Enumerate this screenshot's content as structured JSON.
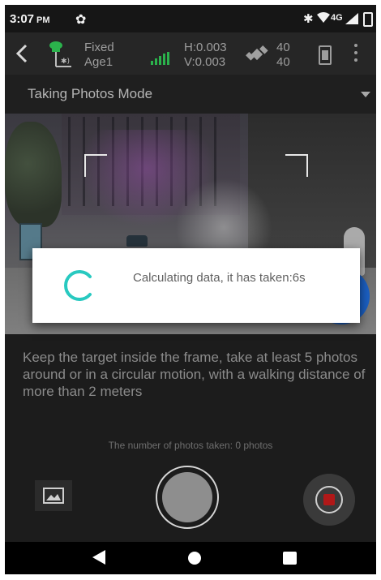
{
  "status_bar": {
    "time": "3:07",
    "ampm": "PM",
    "network_type": "4G",
    "icons": [
      "gear-icon",
      "bluetooth-icon",
      "wifi-icon",
      "signal-icon",
      "battery-icon"
    ]
  },
  "toolbar": {
    "fix_status": "Fixed",
    "age": "Age1",
    "h_precision": "H:0.003",
    "v_precision": "V:0.003",
    "satellites_top": "40",
    "satellites_bottom": "40",
    "icons": [
      "back-arrow-icon",
      "gnss-receiver-icon",
      "signal-bars-icon",
      "satellite-icon",
      "device-battery-icon",
      "more-vert-icon"
    ]
  },
  "mode_selector": {
    "selected": "Taking Photos Mode"
  },
  "dialog": {
    "message": "Calculating data, it has taken:6s"
  },
  "instruction": "Keep the target inside the frame, take at least 5 photos around or in a circular motion, with a walking distance of more than 2 meters",
  "photo_count": "The number of photos taken: 0 photos",
  "controls": {
    "icons": [
      "gallery-icon",
      "shutter-icon",
      "record-icon"
    ]
  },
  "nav_bar": {
    "icons": [
      "nav-back-icon",
      "nav-home-icon",
      "nav-recent-icon"
    ]
  },
  "colors": {
    "accent_spinner": "#28c9c0",
    "signal_green": "#2bb24c",
    "record_red": "#b01818",
    "fab_blue": "#1b5fc2"
  }
}
